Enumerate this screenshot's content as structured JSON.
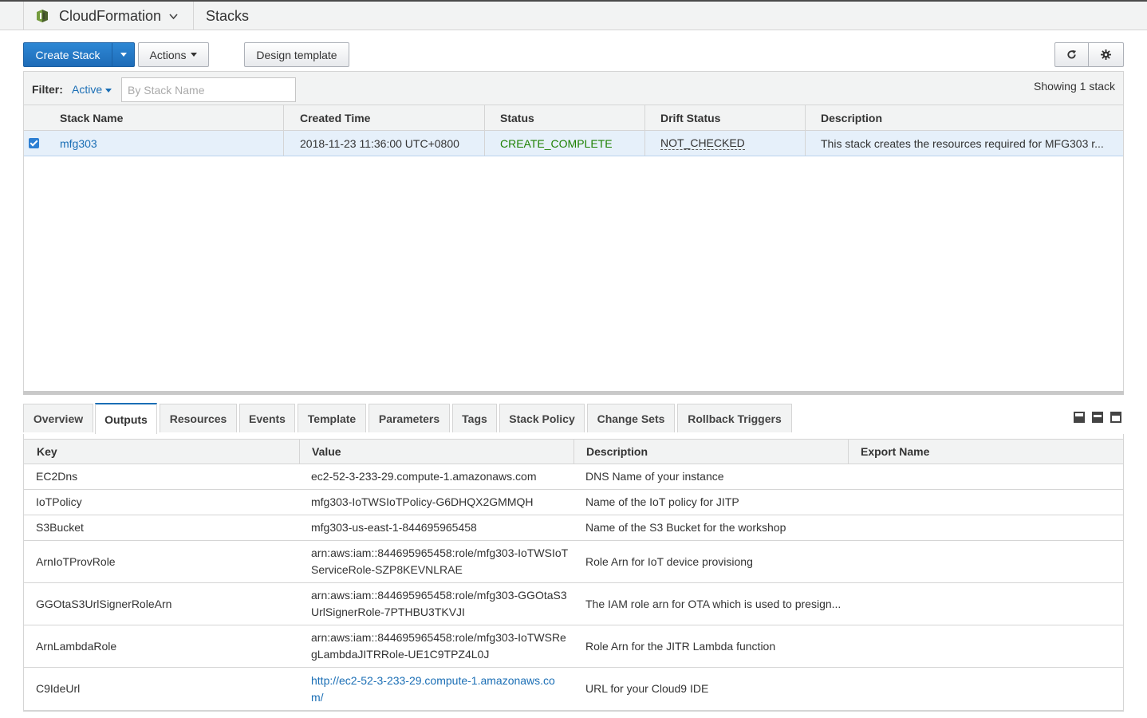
{
  "topbar": {
    "service": "CloudFormation",
    "breadcrumb": "Stacks"
  },
  "toolbar": {
    "create_stack": "Create Stack",
    "actions": "Actions",
    "design_template": "Design template"
  },
  "filter": {
    "label": "Filter:",
    "active": "Active",
    "placeholder": "By Stack Name",
    "showing": "Showing 1 stack"
  },
  "stacks": {
    "headers": {
      "name": "Stack Name",
      "created": "Created Time",
      "status": "Status",
      "drift": "Drift Status",
      "description": "Description"
    },
    "rows": [
      {
        "name": "mfg303",
        "created": "2018-11-23 11:36:00 UTC+0800",
        "status": "CREATE_COMPLETE",
        "drift": "NOT_CHECKED",
        "description": "This stack creates the resources required for MFG303 r..."
      }
    ]
  },
  "tabs": [
    "Overview",
    "Outputs",
    "Resources",
    "Events",
    "Template",
    "Parameters",
    "Tags",
    "Stack Policy",
    "Change Sets",
    "Rollback Triggers"
  ],
  "active_tab": "Outputs",
  "outputs": {
    "headers": {
      "key": "Key",
      "value": "Value",
      "description": "Description",
      "export": "Export Name"
    },
    "rows": [
      {
        "key": "EC2Dns",
        "value_line1": "ec2-52-3-233-29.compute-1.amazonaws.com",
        "value_line2": "",
        "description": "DNS Name of your instance"
      },
      {
        "key": "IoTPolicy",
        "value_line1": "mfg303-IoTWSIoTPolicy-G6DHQX2GMMQH",
        "value_line2": "",
        "description": "Name of the IoT policy for JITP"
      },
      {
        "key": "S3Bucket",
        "value_line1": "mfg303-us-east-1-844695965458",
        "value_line2": "",
        "description": "Name of the S3 Bucket for the workshop"
      },
      {
        "key": "ArnIoTProvRole",
        "value_line1": "arn:aws:iam::844695965458:role/mfg303-IoTWSIoT",
        "value_line2": "ServiceRole-SZP8KEVNLRAE",
        "description": "Role Arn for IoT device provisiong"
      },
      {
        "key": "GGOtaS3UrlSignerRoleArn",
        "value_line1": "arn:aws:iam::844695965458:role/mfg303-GGOtaS3",
        "value_line2": "UrlSignerRole-7PTHBU3TKVJI",
        "description": "The IAM role arn for OTA which is used to presign..."
      },
      {
        "key": "ArnLambdaRole",
        "value_line1": "arn:aws:iam::844695965458:role/mfg303-IoTWSRe",
        "value_line2": "gLambdaJITRRole-UE1C9TPZ4L0J",
        "description": "Role Arn for the JITR Lambda function"
      },
      {
        "key": "C9IdeUrl",
        "value_line1": "http://ec2-52-3-233-29.compute-1.amazonaws.co",
        "value_line2": "m/",
        "description": "URL for your Cloud9 IDE"
      }
    ]
  },
  "colors": {
    "primary": "#1e6cb8",
    "link": "#1a6eb5",
    "success": "#1d8102",
    "selected_row": "#e6f0fa"
  }
}
